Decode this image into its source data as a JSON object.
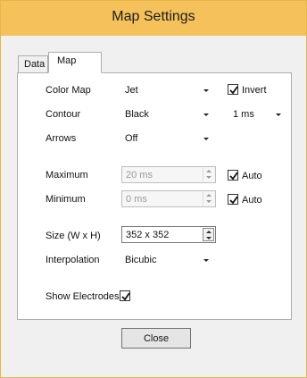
{
  "window": {
    "title": "Map Settings"
  },
  "tabs": [
    {
      "label": "Data"
    },
    {
      "label": "Map",
      "active": true
    }
  ],
  "map": {
    "color_map": {
      "label": "Color Map",
      "value": "Jet"
    },
    "invert": {
      "label": "Invert",
      "checked": true
    },
    "contour": {
      "label": "Contour",
      "value": "Black"
    },
    "contour_step": {
      "value": "1 ms"
    },
    "arrows": {
      "label": "Arrows",
      "value": "Off"
    },
    "maximum": {
      "label": "Maximum",
      "value": "20 ms",
      "enabled": false
    },
    "max_auto": {
      "label": "Auto",
      "checked": true
    },
    "minimum": {
      "label": "Minimum",
      "value": "0 ms",
      "enabled": false
    },
    "min_auto": {
      "label": "Auto",
      "checked": true
    },
    "size": {
      "label": "Size (W x H)",
      "value": "352 x 352"
    },
    "interpolation": {
      "label": "Interpolation",
      "value": "Bicubic"
    },
    "show_electrodes": {
      "label": "Show Electrodes",
      "checked": true
    }
  },
  "buttons": {
    "close": "Close"
  },
  "colors": {
    "titlebar": "#f4c15a",
    "window_border": "#e6b64a"
  }
}
